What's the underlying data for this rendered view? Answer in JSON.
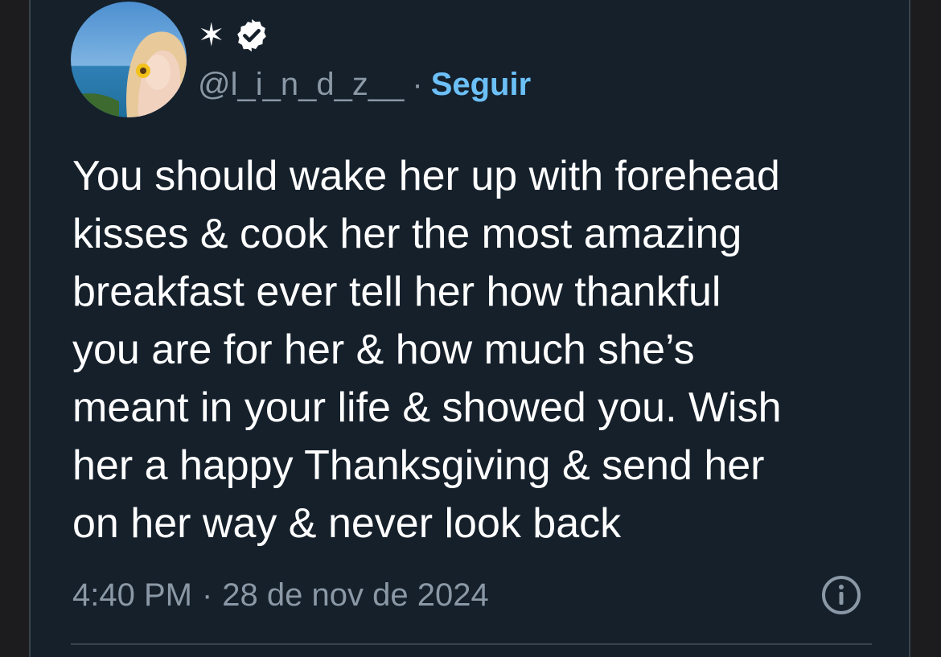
{
  "author": {
    "display_name": "✶",
    "handle": "@l_i_n_d_z__",
    "separator": "·",
    "follow_label": "Seguir",
    "verified": true
  },
  "tweet": {
    "text": "You should wake her up with forehead\nkisses & cook her the most amazing\nbreakfast ever tell her how thankful\nyou are for her & how much she’s\nmeant in your life & showed you. Wish\nher a happy Thanksgiving & send her\non her way & never look back"
  },
  "meta": {
    "time": "4:40 PM",
    "separator": "·",
    "date": "28 de nov de 2024"
  },
  "icons": {
    "verified": "verified-badge-icon",
    "info": "info-icon"
  },
  "colors": {
    "background": "#15202b",
    "text": "#ffffff",
    "secondary": "#8b98a5",
    "accent": "#6cc0f7",
    "border": "#38444d"
  }
}
